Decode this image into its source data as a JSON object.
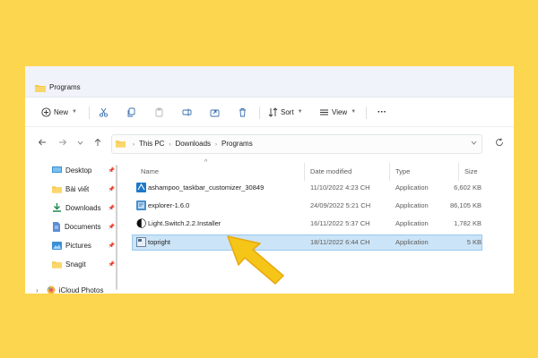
{
  "window": {
    "title": "Programs"
  },
  "toolbar": {
    "new_label": "New",
    "sort_label": "Sort",
    "view_label": "View",
    "more_label": "···"
  },
  "address": {
    "crumbs": [
      "This PC",
      "Downloads",
      "Programs"
    ]
  },
  "sidebar": {
    "items": [
      {
        "label": "Desktop",
        "icon": "desktop-icon",
        "pinned": true
      },
      {
        "label": "Bài viết",
        "icon": "folder-icon",
        "pinned": true
      },
      {
        "label": "Downloads",
        "icon": "downloads-icon",
        "pinned": true
      },
      {
        "label": "Documents",
        "icon": "documents-icon",
        "pinned": true
      },
      {
        "label": "Pictures",
        "icon": "pictures-icon",
        "pinned": true
      },
      {
        "label": "Snagit",
        "icon": "folder-icon",
        "pinned": true
      },
      {
        "label": "iCloud Photos",
        "icon": "icloud-photos-icon",
        "pinned": false
      }
    ]
  },
  "columns": {
    "name": "Name",
    "date": "Date modified",
    "type": "Type",
    "size": "Size"
  },
  "files": [
    {
      "name": "ashampoo_taskbar_customizer_30849",
      "date": "11/10/2022 4:23 CH",
      "type": "Application",
      "size": "6,602 KB",
      "icon": "ashampoo-app-icon"
    },
    {
      "name": "explorer-1.6.0",
      "date": "24/09/2022 5:21 CH",
      "type": "Application",
      "size": "86,105 KB",
      "icon": "explorer-app-icon"
    },
    {
      "name": "Light.Switch.2.2.Installer",
      "date": "16/11/2022 5:37 CH",
      "type": "Application",
      "size": "1,782 KB",
      "icon": "lightswitch-app-icon"
    },
    {
      "name": "topright",
      "date": "18/11/2022 6:44 CH",
      "type": "Application",
      "size": "5 KB",
      "icon": "topright-app-icon",
      "selected": true
    }
  ],
  "colors": {
    "background": "#fdd64f",
    "selection": "#cce4f7",
    "arrow": "#f5c518",
    "folder": "#f8c84a"
  }
}
